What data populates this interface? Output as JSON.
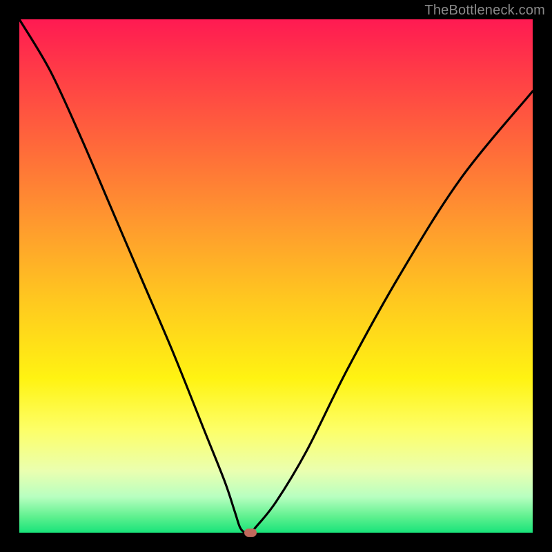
{
  "watermark": "TheBottleneck.com",
  "chart_data": {
    "type": "line",
    "title": "",
    "xlabel": "",
    "ylabel": "",
    "xlim": [
      0,
      100
    ],
    "ylim": [
      0,
      100
    ],
    "series": [
      {
        "name": "bottleneck-curve",
        "x": [
          0,
          6,
          12,
          18,
          24,
          30,
          36,
          40,
          42,
          43,
          44,
          45,
          46,
          50,
          56,
          64,
          74,
          86,
          100
        ],
        "values": [
          100,
          90,
          77,
          63,
          49,
          35,
          20,
          10,
          4,
          1,
          0,
          0,
          1,
          6,
          16,
          32,
          50,
          69,
          86
        ]
      }
    ],
    "annotations": [
      {
        "name": "min-marker",
        "x": 45,
        "y": 0
      }
    ],
    "background_gradient": {
      "top": "#ff1a52",
      "bottom": "#18e37a"
    }
  }
}
